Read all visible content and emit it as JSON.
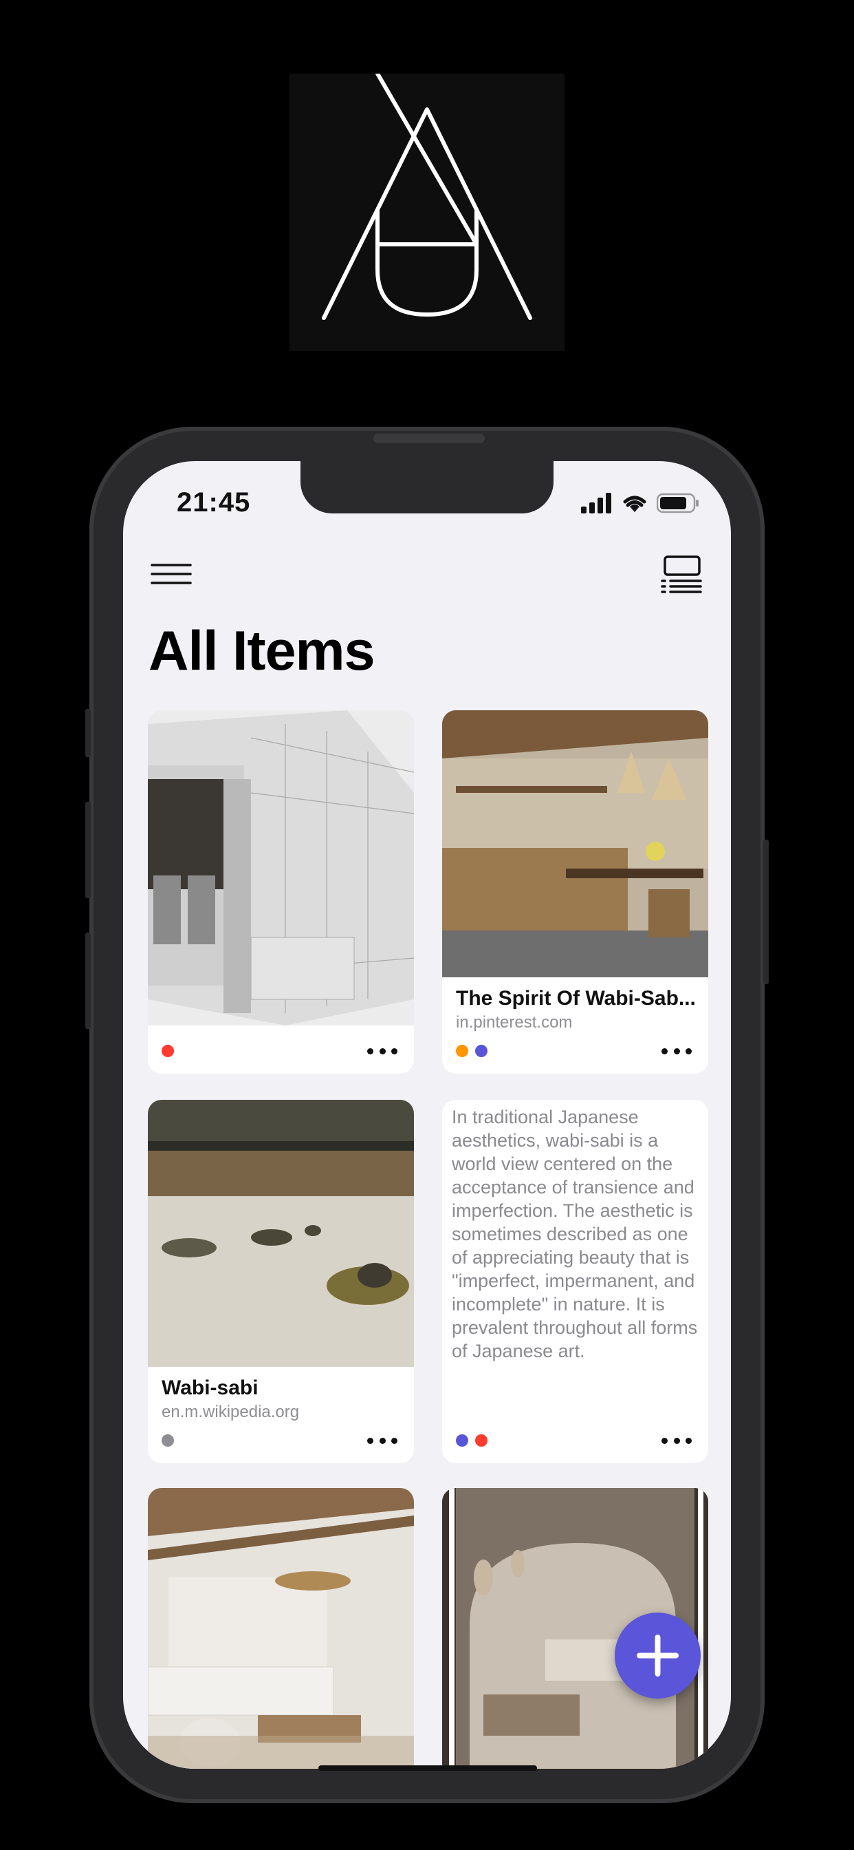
{
  "status_bar": {
    "time": "21:45"
  },
  "page": {
    "title": "All Items"
  },
  "items": [
    {
      "kind": "image",
      "image": "architecture-sketch",
      "title": "",
      "domain": "",
      "tags": [
        "#ff3b30"
      ]
    },
    {
      "kind": "link",
      "image": "wabi-sabi-kitchen",
      "title": "The Spirit Of Wabi-Sab...",
      "domain": "in.pinterest.com",
      "tags": [
        "#ff9500",
        "#5856d6"
      ]
    },
    {
      "kind": "link",
      "image": "zen-rock-garden",
      "title": "Wabi-sabi",
      "domain": "en.m.wikipedia.org",
      "tags": [
        "#8e8e93"
      ]
    },
    {
      "kind": "note",
      "text": "In traditional Japanese aesthetics, wabi-sabi is a world view centered on the acceptance of transience and imperfection. The aesthetic is sometimes described as one of appreciating beauty that is \"imperfect, impermanent, and incomplete\" in nature. It is prevalent throughout all forms of Japanese art.",
      "tags": [
        "#5856d6",
        "#ff3b30"
      ]
    },
    {
      "kind": "image",
      "image": "living-room-interior",
      "title": "",
      "domain": "",
      "tags": []
    },
    {
      "kind": "image",
      "image": "arched-room-interior",
      "title": "",
      "domain": "",
      "tags": []
    }
  ],
  "icons": {
    "menu": "hamburger-menu-icon",
    "view_toggle": "list-view-icon",
    "add": "plus-icon",
    "more": "ellipsis-icon"
  },
  "colors": {
    "accent": "#5b55d9",
    "background": "#f2f1f6"
  }
}
